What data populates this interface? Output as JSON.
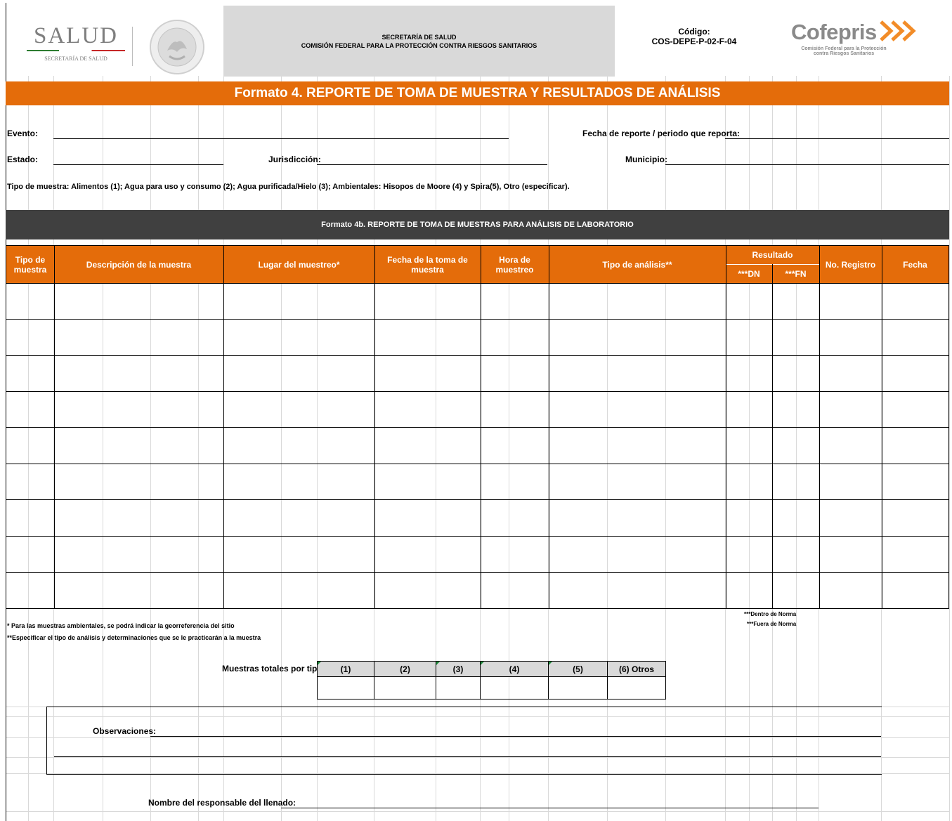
{
  "header": {
    "salud_logo": {
      "text": "SALUD",
      "subtext": "SECRETARÍA DE SALUD"
    },
    "seal_text": "ESTADOS UNIDOS MEXICANOS",
    "secretaria": "SECRETARÍA DE SALUD",
    "comision": "COMISIÓN FEDERAL PARA LA PROTECCIÓN CONTRA RIESGOS SANITARIOS",
    "codigo_label": "Código:",
    "codigo_value": "COS-DEPE-P-02-F-04",
    "cofepris_logo": {
      "text": "Cofepris",
      "line1": "Comisión Federal para la Protección",
      "line2": "contra Riesgos Sanitarios"
    }
  },
  "title": "Formato 4.  REPORTE DE TOMA DE MUESTRA Y RESULTADOS DE ANÁLISIS",
  "fields": {
    "evento": "Evento:",
    "fecha_reporte": "Fecha de reporte / periodo que reporta:",
    "estado": "Estado:",
    "jurisdiccion": "Jurisdicción:",
    "municipio": "Municipio:",
    "tipo_muestra_info": "Tipo de muestra:  Alimentos (1); Agua para uso y consumo (2); Agua purificada/Hielo (3); Ambientales: Hisopos de Moore (4) y Spira(5), Otro (especificar)."
  },
  "subtitle": "Formato 4b.  REPORTE DE TOMA DE MUESTRAS PARA ANÁLISIS DE LABORATORIO",
  "table": {
    "columns": {
      "tipo": "Tipo de muestra",
      "descripcion": "Descripción de la muestra",
      "lugar": "Lugar del muestreo*",
      "fecha_toma": "Fecha de la toma de muestra",
      "hora": "Hora de muestreo",
      "tipo_analisis": "Tipo de análisis**",
      "resultado": "Resultado",
      "dn": "***DN",
      "fn": "***FN",
      "registro": "No. Registro",
      "fecha": "Fecha"
    },
    "row_count": 9
  },
  "notes": {
    "dentro": "***Dentro de Norma",
    "fuera": "***Fuera de Norma",
    "ambientales": "* Para las muestras ambientales, se podrá indicar la georreferencia del sitio",
    "especificar": "**Especificar el tipo de análisis y determinaciones que se le practicarán a la muestra"
  },
  "totals": {
    "label": "Muestras totales por tipo:",
    "types": [
      "(1)",
      "(2)",
      "(3)",
      "(4)",
      "(5)",
      "(6) Otros"
    ]
  },
  "observaciones": "Observaciones:",
  "responsable": "Nombre del responsable del llenado:",
  "colors": {
    "orange": "#e46c0a",
    "dark": "#404040",
    "gray_header": "#d9d9d9",
    "total_header": "#d9d9d9"
  }
}
